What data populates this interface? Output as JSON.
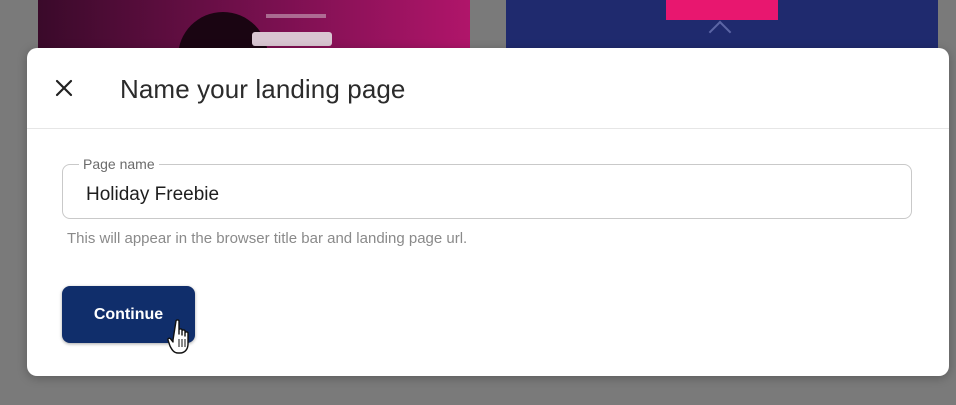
{
  "modal": {
    "title": "Name your landing page",
    "close_icon": "close-icon",
    "field": {
      "label": "Page name",
      "value": "Holiday Freebie",
      "helper": "This will appear in the browser title bar and landing page url."
    },
    "continue_label": "Continue"
  },
  "colors": {
    "primary_button": "#102e6b",
    "backdrop": "#7a7a7a",
    "modal_bg": "#ffffff"
  },
  "icons": {
    "close": "close-icon",
    "cursor": "hand-pointer-cursor-icon"
  }
}
